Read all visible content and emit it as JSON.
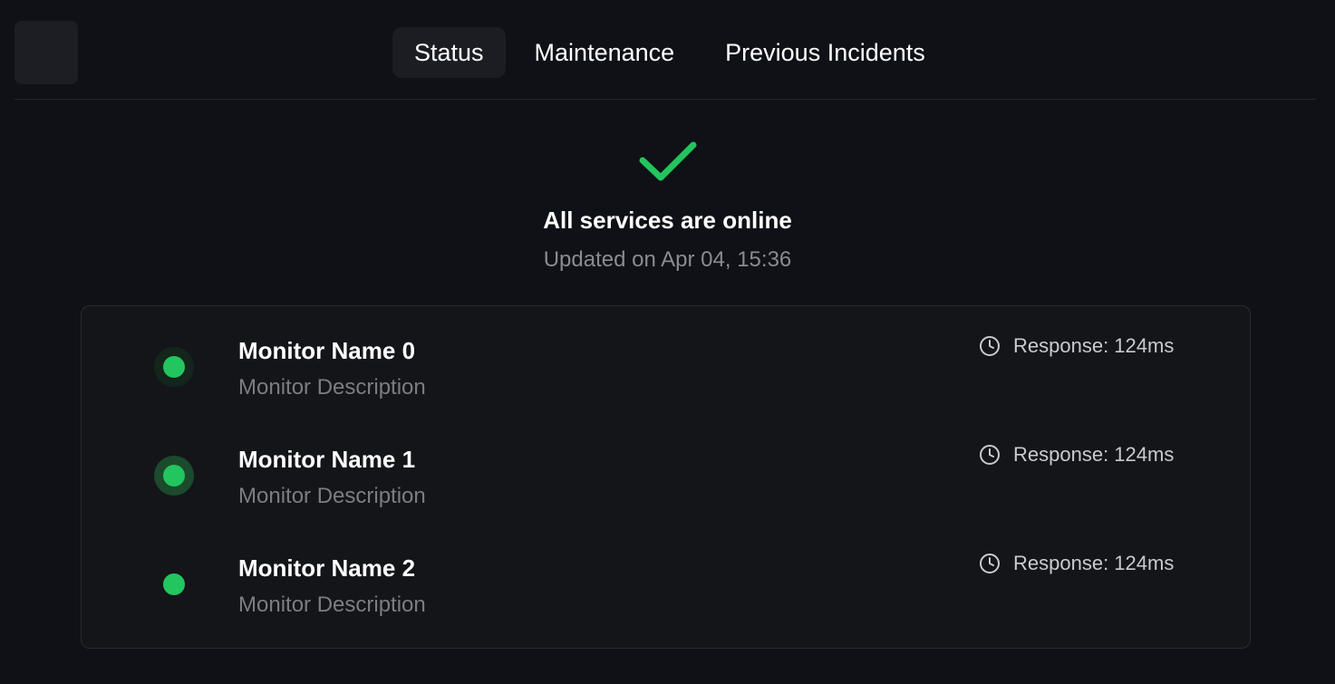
{
  "nav": {
    "tabs": [
      {
        "label": "Status",
        "active": true
      },
      {
        "label": "Maintenance",
        "active": false
      },
      {
        "label": "Previous Incidents",
        "active": false
      }
    ]
  },
  "status": {
    "icon": "checkmark-icon",
    "title": "All services are online",
    "updated": "Updated on Apr 04, 15:36",
    "color": "#22c55e"
  },
  "monitors": [
    {
      "name": "Monitor Name 0",
      "description": "Monitor Description",
      "response": "Response: 124ms",
      "status_color": "#22c55e"
    },
    {
      "name": "Monitor Name 1",
      "description": "Monitor Description",
      "response": "Response: 124ms",
      "status_color": "#22c55e"
    },
    {
      "name": "Monitor Name 2",
      "description": "Monitor Description",
      "response": "Response: 124ms",
      "status_color": "#22c55e"
    }
  ]
}
